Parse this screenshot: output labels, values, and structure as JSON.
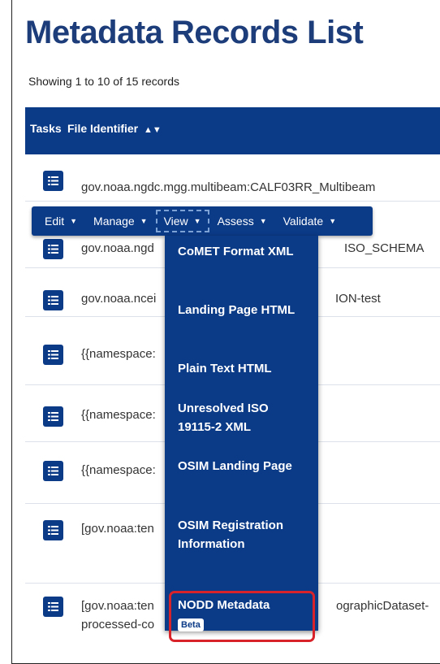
{
  "page": {
    "title": "Metadata Records List",
    "record_count": "Showing 1 to 10 of 15 records"
  },
  "table": {
    "headers": {
      "tasks": "Tasks",
      "file_identifier": "File Identifier",
      "sort_icon": "sort-icon"
    },
    "rows": [
      {
        "file_identifier": "gov.noaa.ngdc.mgg.multibeam:CALF03RR_Multibeam"
      },
      {
        "file_identifier": "gov.noaa.ngd",
        "file_identifier_end": "ISO_SCHEMA"
      },
      {
        "file_identifier": "gov.noaa.ncei",
        "file_identifier_end": "ION-test"
      },
      {
        "file_identifier": "{{namespace:"
      },
      {
        "file_identifier": "{{namespace:"
      },
      {
        "file_identifier": "{{namespace:"
      },
      {
        "file_identifier": "[gov.noaa:ten"
      },
      {
        "file_identifier": "[gov.noaa:ten",
        "file_identifier_end": "ographicDataset-",
        "file_identifier_line2": "processed-co"
      }
    ]
  },
  "action_menu": {
    "items": [
      "Edit",
      "Manage",
      "View",
      "Assess",
      "Validate"
    ],
    "active": "View"
  },
  "view_dropdown": {
    "items": [
      "CoMET Format XML",
      "Landing Page HTML",
      "Plain Text HTML",
      "Unresolved ISO 19115-2 XML",
      "OSIM Landing Page",
      "OSIM Registration Information",
      "NODD Metadata"
    ],
    "badge": "Beta"
  },
  "colors": {
    "primary": "#0b3a87",
    "title": "#1c3d7a",
    "highlight": "#d8232a"
  },
  "icons": {
    "task_button": "list-icon",
    "caret": "caret-down-icon"
  }
}
